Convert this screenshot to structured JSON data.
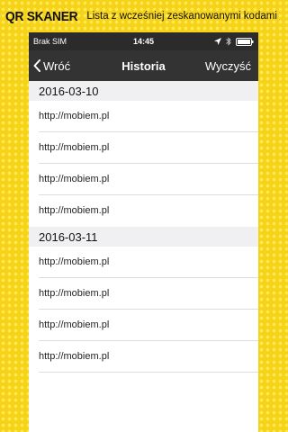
{
  "banner": {
    "logo": "QR SKANER",
    "subtitle": "Lista z wcześniej zeskanowanymi kodami"
  },
  "status_bar": {
    "carrier": "Brak SIM",
    "time": "14:45",
    "icons": [
      "location-arrow-icon",
      "bluetooth-icon",
      "battery-icon"
    ]
  },
  "nav_bar": {
    "back_label": "Wróć",
    "title": "Historia",
    "clear_label": "Wyczyść"
  },
  "sections": [
    {
      "date": "2016-03-10",
      "items": [
        "http://mobiem.pl",
        "http://mobiem.pl",
        "http://mobiem.pl",
        "http://mobiem.pl"
      ]
    },
    {
      "date": "2016-03-11",
      "items": [
        "http://mobiem.pl",
        "http://mobiem.pl",
        "http://mobiem.pl",
        "http://mobiem.pl"
      ]
    }
  ],
  "colors": {
    "background": "#f7d21a",
    "status_bar": "#2b2b2b",
    "nav_bar": "#333333",
    "section_header": "#f0f0f2"
  }
}
